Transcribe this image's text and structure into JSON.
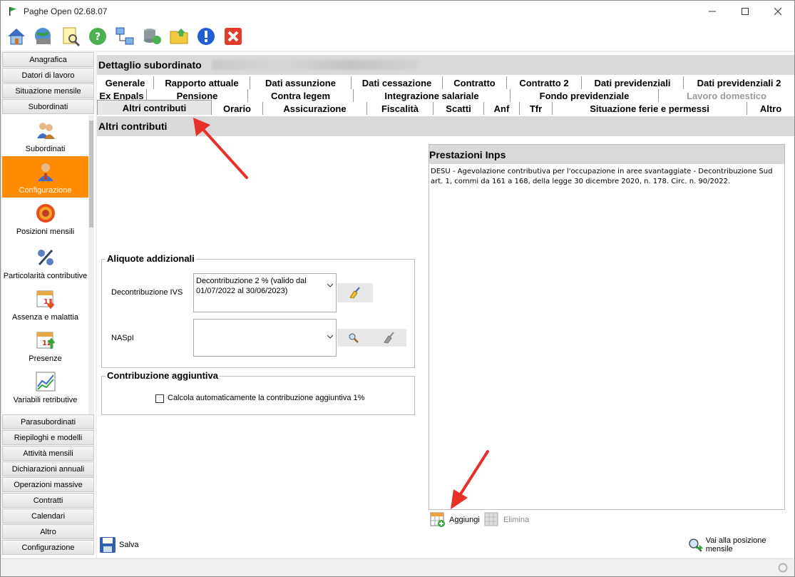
{
  "window": {
    "title": "Paghe Open 02.68.07"
  },
  "left_nav": {
    "top_items": [
      "Anagrafica",
      "Datori di lavoro",
      "Situazione mensile",
      "Subordinati"
    ],
    "sub_items": [
      {
        "label": "Subordinati",
        "icon": "people-icon"
      },
      {
        "label": "Configurazione",
        "icon": "person-gear-icon",
        "selected": true
      },
      {
        "label": "Posizioni mensili",
        "icon": "target-icon"
      },
      {
        "label": "Particolarità contributive",
        "icon": "percent-icon"
      },
      {
        "label": "Assenza e malattia",
        "icon": "calendar-down-icon"
      },
      {
        "label": "Presenze",
        "icon": "calendar-up-icon"
      },
      {
        "label": "Variabili retributive",
        "icon": "chart-icon"
      }
    ],
    "bottom_items": [
      "Parasubordinati",
      "Riepiloghi e modelli",
      "Attività mensili",
      "Dichiarazioni annuali",
      "Operazioni massive",
      "Contratti",
      "Calendari",
      "Altro",
      "Configurazione"
    ]
  },
  "main": {
    "header_title": "Dettaglio subordinato",
    "tabs_row1": [
      "Generale",
      "Rapporto attuale",
      "Dati assunzione",
      "Dati cessazione",
      "Contratto",
      "Contratto 2",
      "Dati previdenziali",
      "Dati previdenziali 2"
    ],
    "tabs_row2": [
      "Ex Enpals",
      "Pensione",
      "Contra legem",
      "Integrazione salariale",
      "Fondo previdenziale",
      "Lavoro domestico"
    ],
    "tabs_row3": [
      "Altri contributi",
      "Orario",
      "Assicurazione",
      "Fiscalità",
      "Scatti",
      "Anf",
      "Tfr",
      "Situazione ferie e permessi",
      "Altro"
    ],
    "section_title": "Altri contributi",
    "aliquote": {
      "title": "Aliquote addizionali",
      "decontribuzione_label": "Decontribuzione IVS",
      "decontribuzione_value": "Decontribuzione 2 % (valido dal 01/07/2022 al 30/06/2023)",
      "naspi_label": "NASpI",
      "naspi_value": ""
    },
    "contribuzione": {
      "title": "Contribuzione aggiuntiva",
      "checkbox_label": "Calcola automaticamente la contribuzione aggiuntiva 1%",
      "checked": false
    },
    "prestazioni": {
      "title": "Prestazioni Inps",
      "text": "DESU - Agevolazione contributiva per l'occupazione in aree svantaggiate - Decontribuzione Sud art. 1, commi da 161 a 168, della legge 30 dicembre 2020, n. 178. Circ. n. 90/2022.",
      "add_label": "Aggiungi",
      "delete_label": "Elimina"
    },
    "save_label": "Salva",
    "goto_label": "Vai alla posizione mensile"
  }
}
